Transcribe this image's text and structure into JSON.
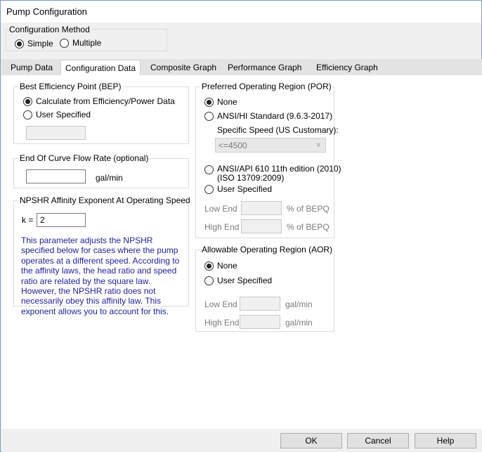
{
  "window": {
    "title": "Pump Configuration"
  },
  "config_method": {
    "label": "Configuration Method",
    "options": [
      "Simple",
      "Multiple"
    ],
    "selected": "Simple"
  },
  "tabs": [
    "Pump Data",
    "Configuration Data",
    "Composite Graph",
    "Performance Graph",
    "Efficiency Graph"
  ],
  "active_tab": "Configuration Data",
  "bep": {
    "label": "Best Efficiency Point (BEP)",
    "options": [
      "Calculate from Efficiency/Power Data",
      "User Specified"
    ],
    "value": ""
  },
  "eoc": {
    "label": "End Of Curve Flow Rate (optional)",
    "value": "",
    "unit": "gal/min"
  },
  "npshr": {
    "label": "NPSHR Affinity Exponent At Operating Speed",
    "k_label": "k =",
    "k_value": "2",
    "note": "This parameter adjusts the NPSHR specified below for cases where the pump operates at a different speed. According to the affinity laws, the head ratio and speed ratio are related by the square law. However, the NPSHR ratio does not necessarily obey this affinity law. This exponent allows you to account for this."
  },
  "por": {
    "label": "Preferred Operating Region (POR)",
    "opt_none": "None",
    "opt_ansi_hi": "ANSI/HI Standard (9.6.3-2017)",
    "specific_speed_label": "Specific Speed (US Customary):",
    "specific_speed_value": "<=4500",
    "opt_api_line1": "ANSI/API 610 11th edition (2010)",
    "opt_api_line2": "(ISO 13709:2009)",
    "opt_user": "User Specified",
    "low_end_label": "Low End",
    "high_end_label": "High End",
    "unit": "% of BEPQ"
  },
  "aor": {
    "label": "Allowable Operating Region (AOR)",
    "opt_none": "None",
    "opt_user": "User Specified",
    "low_end_label": "Low End",
    "high_end_label": "High End",
    "unit": "gal/min"
  },
  "buttons": {
    "ok": "OK",
    "cancel": "Cancel",
    "help": "Help"
  },
  "colors": {
    "note_text": "#1e1e9a",
    "window_border": "#7a9cc0"
  }
}
